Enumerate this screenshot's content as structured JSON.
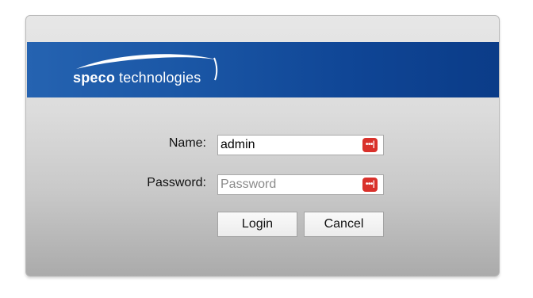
{
  "brand": {
    "name_bold": "speco",
    "name_regular": "technologies",
    "banner_color": "#1a56a5",
    "logo_swoosh_icon": "swoosh-arc"
  },
  "form": {
    "name_label": "Name:",
    "name_value": "admin",
    "password_label": "Password:",
    "password_placeholder": "Password",
    "password_value": "",
    "field_icon": "password-manager-key-icon",
    "field_icon_color": "#d9312b",
    "field_icon_text": "•••|"
  },
  "buttons": {
    "login_label": "Login",
    "cancel_label": "Cancel"
  }
}
